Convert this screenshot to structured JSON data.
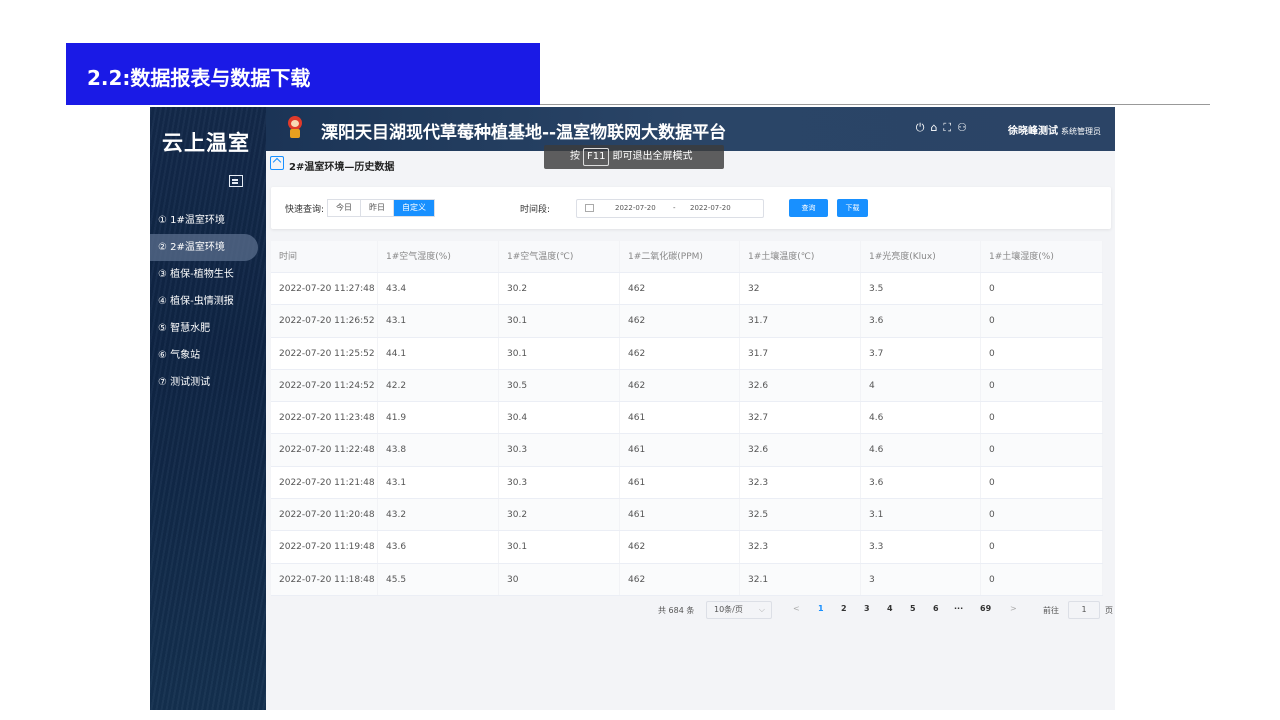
{
  "slide": {
    "title": "2.2:数据报表与数据下载"
  },
  "sidebar": {
    "logo": "云上温室",
    "items": [
      {
        "label": "① 1#温室环境"
      },
      {
        "label": "② 2#温室环境"
      },
      {
        "label": "③ 植保-植物生长"
      },
      {
        "label": "④ 植保-虫情测报"
      },
      {
        "label": "⑤ 智慧水肥"
      },
      {
        "label": "⑥ 气象站"
      },
      {
        "label": "⑦ 测试测试"
      }
    ]
  },
  "header": {
    "title": "溧阳天目湖现代草莓种植基地--温室物联网大数据平台",
    "icons": [
      "power-icon",
      "home-icon",
      "fullscreen-icon",
      "user-icon"
    ],
    "user_name": "徐晓峰测试",
    "user_role": "系统管理员",
    "f11_prefix": "按",
    "f11_key": "F11",
    "f11_suffix": "即可退出全屏模式"
  },
  "page": {
    "title": "2#温室环境—历史数据"
  },
  "filter": {
    "quick_label": "快速查询:",
    "quick_options": [
      "今日",
      "昨日",
      "自定义"
    ],
    "selected": "自定义",
    "period_label": "时间段:",
    "date_start": "2022-07-20",
    "date_sep": "-",
    "date_end": "2022-07-20",
    "query_button": "查询",
    "download_button": "下载"
  },
  "table": {
    "columns": [
      "时间",
      "1#空气湿度(%)",
      "1#空气温度(℃)",
      "1#二氧化碳(PPM)",
      "1#土壤温度(℃)",
      "1#光亮度(Klux)",
      "1#土壤湿度(%)"
    ],
    "rows": [
      [
        "2022-07-20 11:27:48",
        "43.4",
        "30.2",
        "462",
        "32",
        "3.5",
        "0"
      ],
      [
        "2022-07-20 11:26:52",
        "43.1",
        "30.1",
        "462",
        "31.7",
        "3.6",
        "0"
      ],
      [
        "2022-07-20 11:25:52",
        "44.1",
        "30.1",
        "462",
        "31.7",
        "3.7",
        "0"
      ],
      [
        "2022-07-20 11:24:52",
        "42.2",
        "30.5",
        "462",
        "32.6",
        "4",
        "0"
      ],
      [
        "2022-07-20 11:23:48",
        "41.9",
        "30.4",
        "461",
        "32.7",
        "4.6",
        "0"
      ],
      [
        "2022-07-20 11:22:48",
        "43.8",
        "30.3",
        "461",
        "32.6",
        "4.6",
        "0"
      ],
      [
        "2022-07-20 11:21:48",
        "43.1",
        "30.3",
        "461",
        "32.3",
        "3.6",
        "0"
      ],
      [
        "2022-07-20 11:20:48",
        "43.2",
        "30.2",
        "461",
        "32.5",
        "3.1",
        "0"
      ],
      [
        "2022-07-20 11:19:48",
        "43.6",
        "30.1",
        "462",
        "32.3",
        "3.3",
        "0"
      ],
      [
        "2022-07-20 11:18:48",
        "45.5",
        "30",
        "462",
        "32.1",
        "3",
        "0"
      ]
    ]
  },
  "pagination": {
    "total": "共 684 条",
    "page_size": "10条/页",
    "prev": "<",
    "next": ">",
    "pages": [
      "1",
      "2",
      "3",
      "4",
      "5",
      "6",
      "···",
      "69"
    ],
    "current": "1",
    "goto_label": "前往",
    "goto_value": "1",
    "goto_suffix": "页"
  }
}
